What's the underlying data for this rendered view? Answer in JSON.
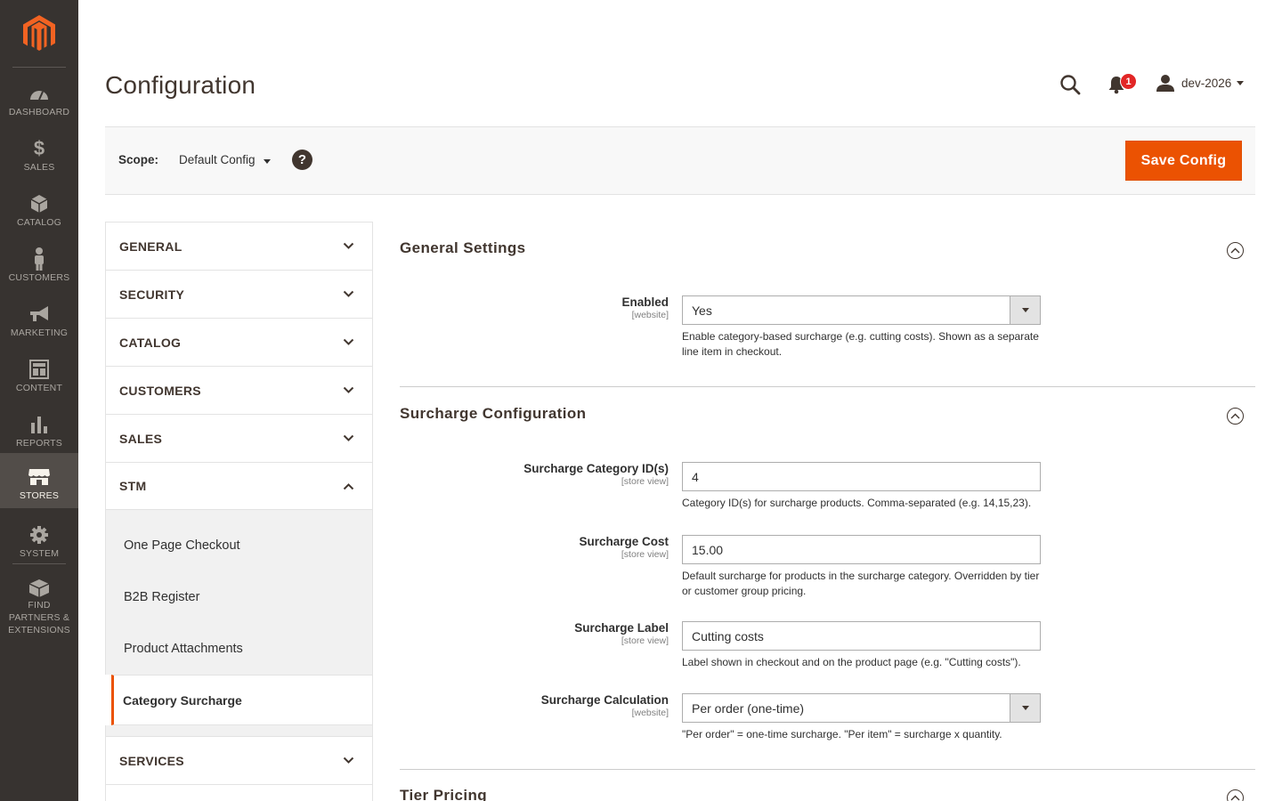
{
  "menu": {
    "items": [
      {
        "label": "DASHBOARD",
        "icon": "dashboard-icon"
      },
      {
        "label": "SALES",
        "icon": "dollar-icon"
      },
      {
        "label": "CATALOG",
        "icon": "box-icon"
      },
      {
        "label": "CUSTOMERS",
        "icon": "person-icon"
      },
      {
        "label": "MARKETING",
        "icon": "megaphone-icon"
      },
      {
        "label": "CONTENT",
        "icon": "layout-icon"
      },
      {
        "label": "REPORTS",
        "icon": "bar-chart-icon"
      },
      {
        "label": "STORES",
        "icon": "storefront-icon"
      },
      {
        "label": "SYSTEM",
        "icon": "gear-icon"
      },
      {
        "label": "FIND PARTNERS & EXTENSIONS",
        "icon": "puzzle-box-icon"
      }
    ],
    "active": "STORES"
  },
  "header": {
    "title": "Configuration",
    "notification_count": "1",
    "username": "dev-2026"
  },
  "scope": {
    "label": "Scope:",
    "value": "Default Config",
    "help": "?"
  },
  "actions": {
    "save_label": "Save Config"
  },
  "tabs": {
    "general": "GENERAL",
    "security": "SECURITY",
    "catalog": "CATALOG",
    "customers": "CUSTOMERS",
    "sales": "SALES",
    "stm": "STM",
    "stm_items": [
      "One Page Checkout",
      "B2B Register",
      "Product Attachments",
      "Category Surcharge"
    ],
    "services": "SERVICES"
  },
  "sections": {
    "general": {
      "title": "General Settings",
      "enabled": {
        "label": "Enabled",
        "scope": "[website]",
        "value": "Yes",
        "note": "Enable category-based surcharge (e.g. cutting costs). Shown as a separate line item in checkout."
      }
    },
    "surcharge": {
      "title": "Surcharge Configuration",
      "category_ids": {
        "label": "Surcharge Category ID(s)",
        "scope": "[store view]",
        "value": "4",
        "note": "Category ID(s) for surcharge products. Comma-separated (e.g. 14,15,23)."
      },
      "cost": {
        "label": "Surcharge Cost",
        "scope": "[store view]",
        "value": "15.00",
        "note": "Default surcharge for products in the surcharge category. Overridden by tier or customer group pricing."
      },
      "label_field": {
        "label": "Surcharge Label",
        "scope": "[store view]",
        "value": "Cutting costs",
        "note": "Label shown in checkout and on the product page (e.g. \"Cutting costs\")."
      },
      "calculation": {
        "label": "Surcharge Calculation",
        "scope": "[website]",
        "value": "Per order (one-time)",
        "note": "\"Per order\" = one-time surcharge. \"Per item\" = surcharge x quantity."
      }
    },
    "tier": {
      "title": "Tier Pricing"
    }
  },
  "colors": {
    "accent": "#eb5202",
    "menu_bg": "#373330",
    "menu_active": "#524d49",
    "badge": "#e22626"
  }
}
